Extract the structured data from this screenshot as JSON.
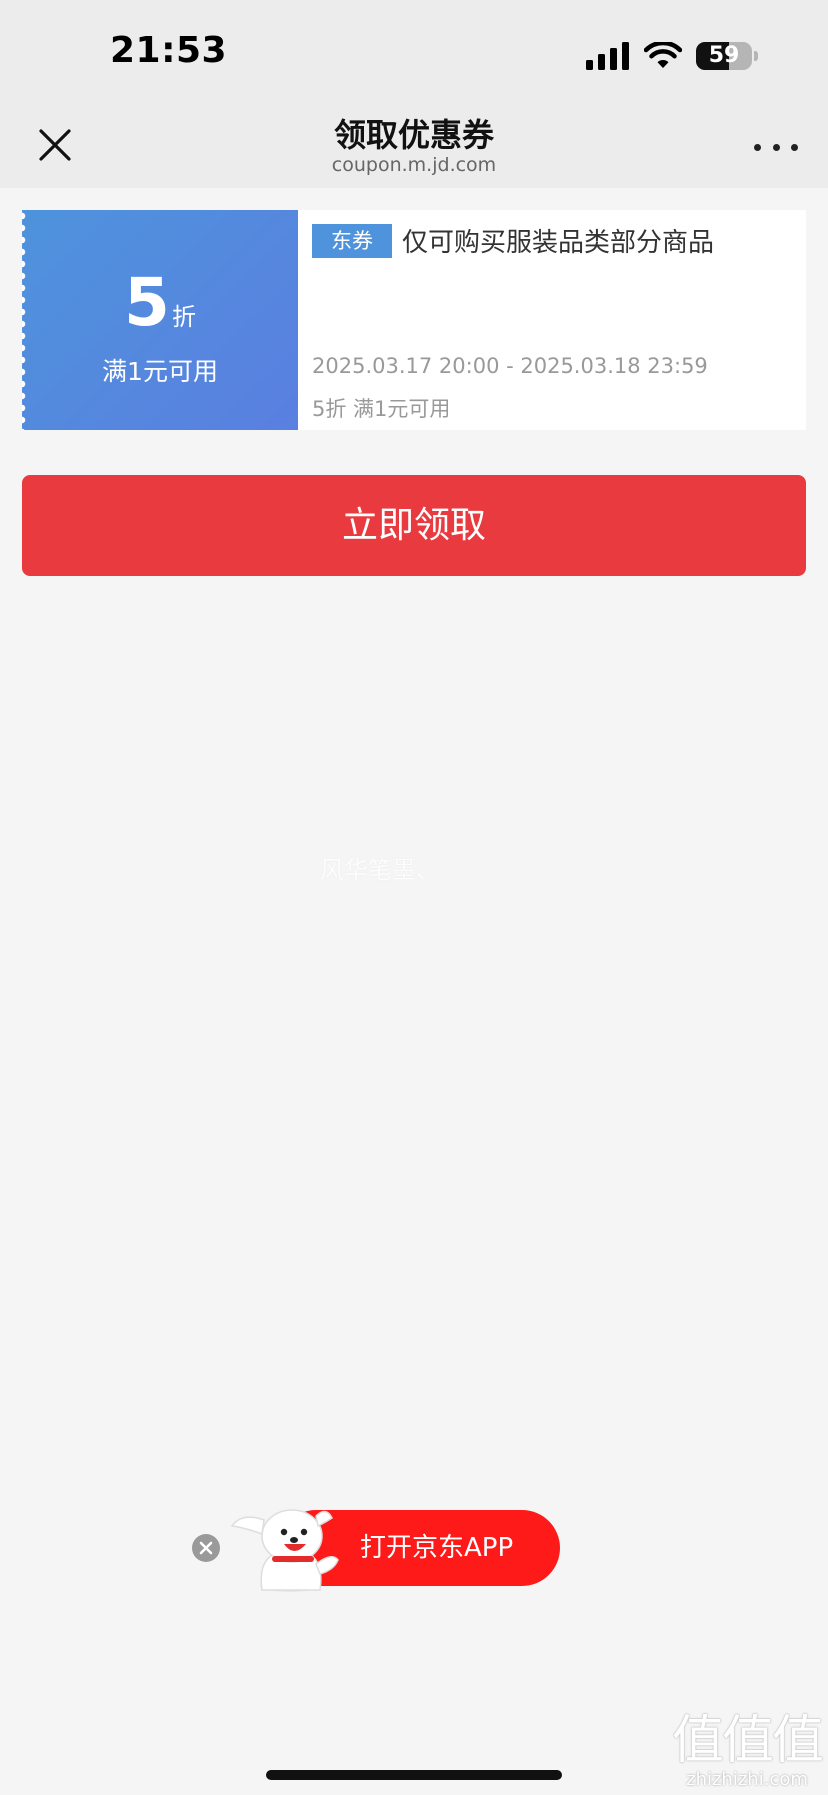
{
  "status_bar": {
    "time": "21:53",
    "battery": "59",
    "battery_level": 0.59,
    "icons": [
      "cellular-signal-icon",
      "wifi-icon",
      "battery-icon"
    ]
  },
  "nav": {
    "title": "领取优惠券",
    "subtitle": "coupon.m.jd.com",
    "icons": [
      "close-icon",
      "more-icon"
    ]
  },
  "coupon": {
    "discount_value": "5",
    "discount_unit": "折",
    "condition": "满1元可用",
    "tag": "东券",
    "description": "仅可购买服装品类部分商品",
    "validity": "2025.03.17 20:00 - 2025.03.18 23:59",
    "rule": "5折 满1元可用"
  },
  "claim_button": "立即领取",
  "watermark": "风华笔墨、",
  "app_banner": {
    "label": "打开京东APP",
    "icons": [
      "close-icon",
      "mascot-icon"
    ]
  },
  "site_logo": {
    "text": "值值值",
    "domain": "zhizhizhi.com"
  },
  "colors": {
    "accent_red": "#e83a3f",
    "coupon_blue": "#4e93dc",
    "app_red": "#ff1a1a"
  }
}
